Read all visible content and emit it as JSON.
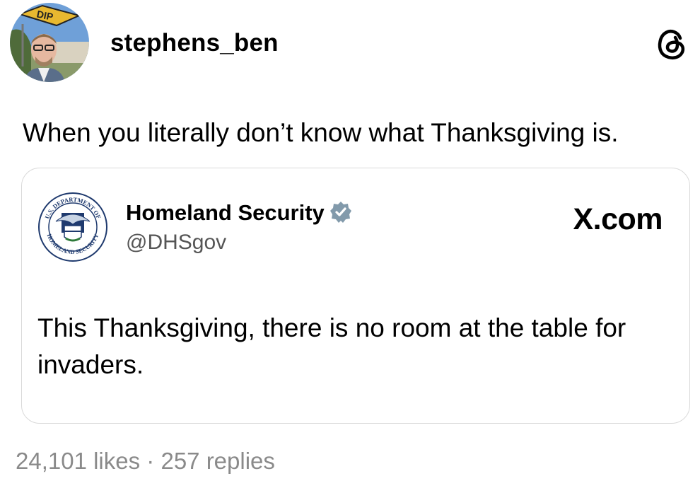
{
  "post": {
    "username": "stephens_ben",
    "text": "When you literally don’t know what Thanksgiving is.",
    "avatar_sign_text": "DIP",
    "platform_icon": "threads-icon"
  },
  "quote": {
    "name": "Homeland Security",
    "handle": "@DHSgov",
    "source": "X.com",
    "verified_icon": "verified-badge-icon",
    "seal_text_top": "U.S. DEPARTMENT OF",
    "seal_text_bottom": "HOMELAND SECURITY",
    "text": "This Thanksgiving, there is no room at the table for invaders."
  },
  "stats": {
    "likes": "24,101 likes",
    "separator": "·",
    "replies": "257 replies"
  },
  "colors": {
    "muted_text": "#8a8a8a",
    "card_border": "#d9d9d9",
    "verified_badge": "#829aab",
    "seal_blue": "#1f3a6e"
  }
}
